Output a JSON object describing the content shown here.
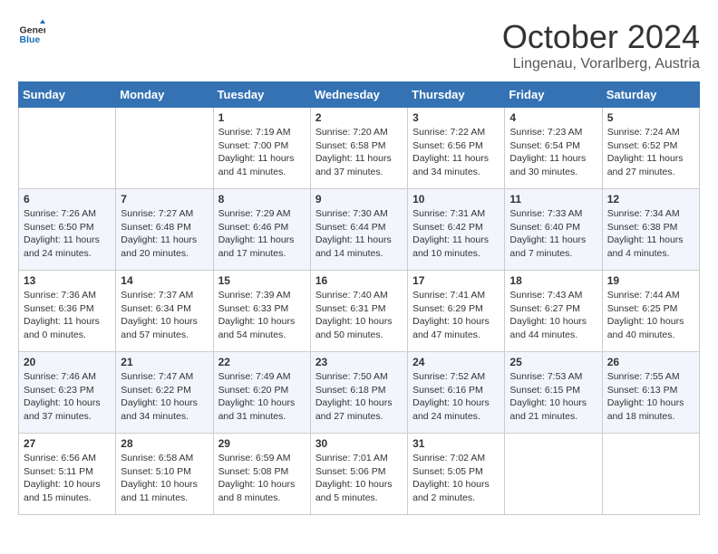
{
  "logo": {
    "text_general": "General",
    "text_blue": "Blue"
  },
  "header": {
    "month": "October 2024",
    "location": "Lingenau, Vorarlberg, Austria"
  },
  "weekdays": [
    "Sunday",
    "Monday",
    "Tuesday",
    "Wednesday",
    "Thursday",
    "Friday",
    "Saturday"
  ],
  "weeks": [
    [
      {
        "day": "",
        "empty": true
      },
      {
        "day": "",
        "empty": true
      },
      {
        "day": "1",
        "sunrise": "7:19 AM",
        "sunset": "7:00 PM",
        "daylight": "11 hours and 41 minutes."
      },
      {
        "day": "2",
        "sunrise": "7:20 AM",
        "sunset": "6:58 PM",
        "daylight": "11 hours and 37 minutes."
      },
      {
        "day": "3",
        "sunrise": "7:22 AM",
        "sunset": "6:56 PM",
        "daylight": "11 hours and 34 minutes."
      },
      {
        "day": "4",
        "sunrise": "7:23 AM",
        "sunset": "6:54 PM",
        "daylight": "11 hours and 30 minutes."
      },
      {
        "day": "5",
        "sunrise": "7:24 AM",
        "sunset": "6:52 PM",
        "daylight": "11 hours and 27 minutes."
      }
    ],
    [
      {
        "day": "6",
        "sunrise": "7:26 AM",
        "sunset": "6:50 PM",
        "daylight": "11 hours and 24 minutes."
      },
      {
        "day": "7",
        "sunrise": "7:27 AM",
        "sunset": "6:48 PM",
        "daylight": "11 hours and 20 minutes."
      },
      {
        "day": "8",
        "sunrise": "7:29 AM",
        "sunset": "6:46 PM",
        "daylight": "11 hours and 17 minutes."
      },
      {
        "day": "9",
        "sunrise": "7:30 AM",
        "sunset": "6:44 PM",
        "daylight": "11 hours and 14 minutes."
      },
      {
        "day": "10",
        "sunrise": "7:31 AM",
        "sunset": "6:42 PM",
        "daylight": "11 hours and 10 minutes."
      },
      {
        "day": "11",
        "sunrise": "7:33 AM",
        "sunset": "6:40 PM",
        "daylight": "11 hours and 7 minutes."
      },
      {
        "day": "12",
        "sunrise": "7:34 AM",
        "sunset": "6:38 PM",
        "daylight": "11 hours and 4 minutes."
      }
    ],
    [
      {
        "day": "13",
        "sunrise": "7:36 AM",
        "sunset": "6:36 PM",
        "daylight": "11 hours and 0 minutes."
      },
      {
        "day": "14",
        "sunrise": "7:37 AM",
        "sunset": "6:34 PM",
        "daylight": "10 hours and 57 minutes."
      },
      {
        "day": "15",
        "sunrise": "7:39 AM",
        "sunset": "6:33 PM",
        "daylight": "10 hours and 54 minutes."
      },
      {
        "day": "16",
        "sunrise": "7:40 AM",
        "sunset": "6:31 PM",
        "daylight": "10 hours and 50 minutes."
      },
      {
        "day": "17",
        "sunrise": "7:41 AM",
        "sunset": "6:29 PM",
        "daylight": "10 hours and 47 minutes."
      },
      {
        "day": "18",
        "sunrise": "7:43 AM",
        "sunset": "6:27 PM",
        "daylight": "10 hours and 44 minutes."
      },
      {
        "day": "19",
        "sunrise": "7:44 AM",
        "sunset": "6:25 PM",
        "daylight": "10 hours and 40 minutes."
      }
    ],
    [
      {
        "day": "20",
        "sunrise": "7:46 AM",
        "sunset": "6:23 PM",
        "daylight": "10 hours and 37 minutes."
      },
      {
        "day": "21",
        "sunrise": "7:47 AM",
        "sunset": "6:22 PM",
        "daylight": "10 hours and 34 minutes."
      },
      {
        "day": "22",
        "sunrise": "7:49 AM",
        "sunset": "6:20 PM",
        "daylight": "10 hours and 31 minutes."
      },
      {
        "day": "23",
        "sunrise": "7:50 AM",
        "sunset": "6:18 PM",
        "daylight": "10 hours and 27 minutes."
      },
      {
        "day": "24",
        "sunrise": "7:52 AM",
        "sunset": "6:16 PM",
        "daylight": "10 hours and 24 minutes."
      },
      {
        "day": "25",
        "sunrise": "7:53 AM",
        "sunset": "6:15 PM",
        "daylight": "10 hours and 21 minutes."
      },
      {
        "day": "26",
        "sunrise": "7:55 AM",
        "sunset": "6:13 PM",
        "daylight": "10 hours and 18 minutes."
      }
    ],
    [
      {
        "day": "27",
        "sunrise": "6:56 AM",
        "sunset": "5:11 PM",
        "daylight": "10 hours and 15 minutes."
      },
      {
        "day": "28",
        "sunrise": "6:58 AM",
        "sunset": "5:10 PM",
        "daylight": "10 hours and 11 minutes."
      },
      {
        "day": "29",
        "sunrise": "6:59 AM",
        "sunset": "5:08 PM",
        "daylight": "10 hours and 8 minutes."
      },
      {
        "day": "30",
        "sunrise": "7:01 AM",
        "sunset": "5:06 PM",
        "daylight": "10 hours and 5 minutes."
      },
      {
        "day": "31",
        "sunrise": "7:02 AM",
        "sunset": "5:05 PM",
        "daylight": "10 hours and 2 minutes."
      },
      {
        "day": "",
        "empty": true
      },
      {
        "day": "",
        "empty": true
      }
    ]
  ]
}
